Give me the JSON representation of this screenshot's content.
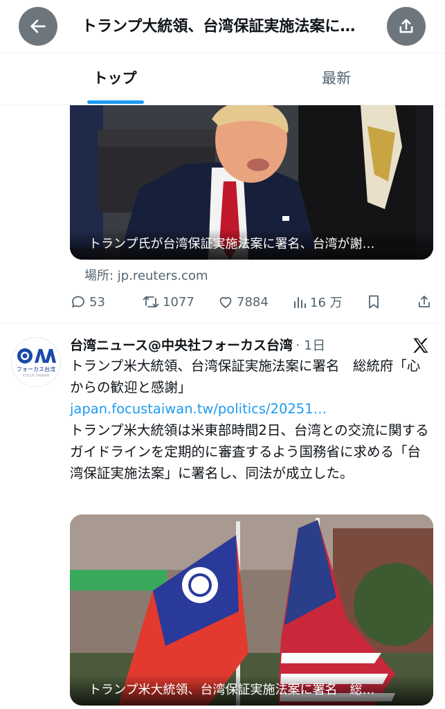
{
  "header": {
    "title": "トランプ大統領、台湾保証実施法案に…",
    "back_icon": "arrow-left-icon",
    "share_icon": "share-icon"
  },
  "tabs": [
    {
      "label": "トップ",
      "active": true
    },
    {
      "label": "最新",
      "active": false
    }
  ],
  "card1": {
    "caption": "トランプ氏が台湾保証実施法案に署名、台湾が謝…",
    "source": "場所: jp.reuters.com",
    "actions": {
      "replies": "53",
      "reposts": "1077",
      "likes": "7884",
      "views": "16 万"
    }
  },
  "tweet2": {
    "author": "台湾ニュース@中央社フォーカス台湾",
    "meta": "· 1日",
    "avatar_text": "フォーカス台湾",
    "avatar_logo": "CNA",
    "avatar_sub": "FOCUS TAIWAN",
    "headline": "トランプ米大統領、台湾保証実施法案に署名　総統府「心からの歓迎と感謝」",
    "link": "japan.focustaiwan.tw/politics/20251…",
    "body": "トランプ米大統領は米東部時間2日、台湾との交流に関するガイドラインを定期的に審査するよう国務省に求める「台湾保証実施法案」に署名し、同法が成立した。",
    "media_caption": "トランプ米大統領、台湾保証実施法案に署名　総…"
  },
  "colors": {
    "accent": "#1d9bf0",
    "text": "#0f1419",
    "muted": "#536471",
    "button_gray": "#6e767d"
  }
}
